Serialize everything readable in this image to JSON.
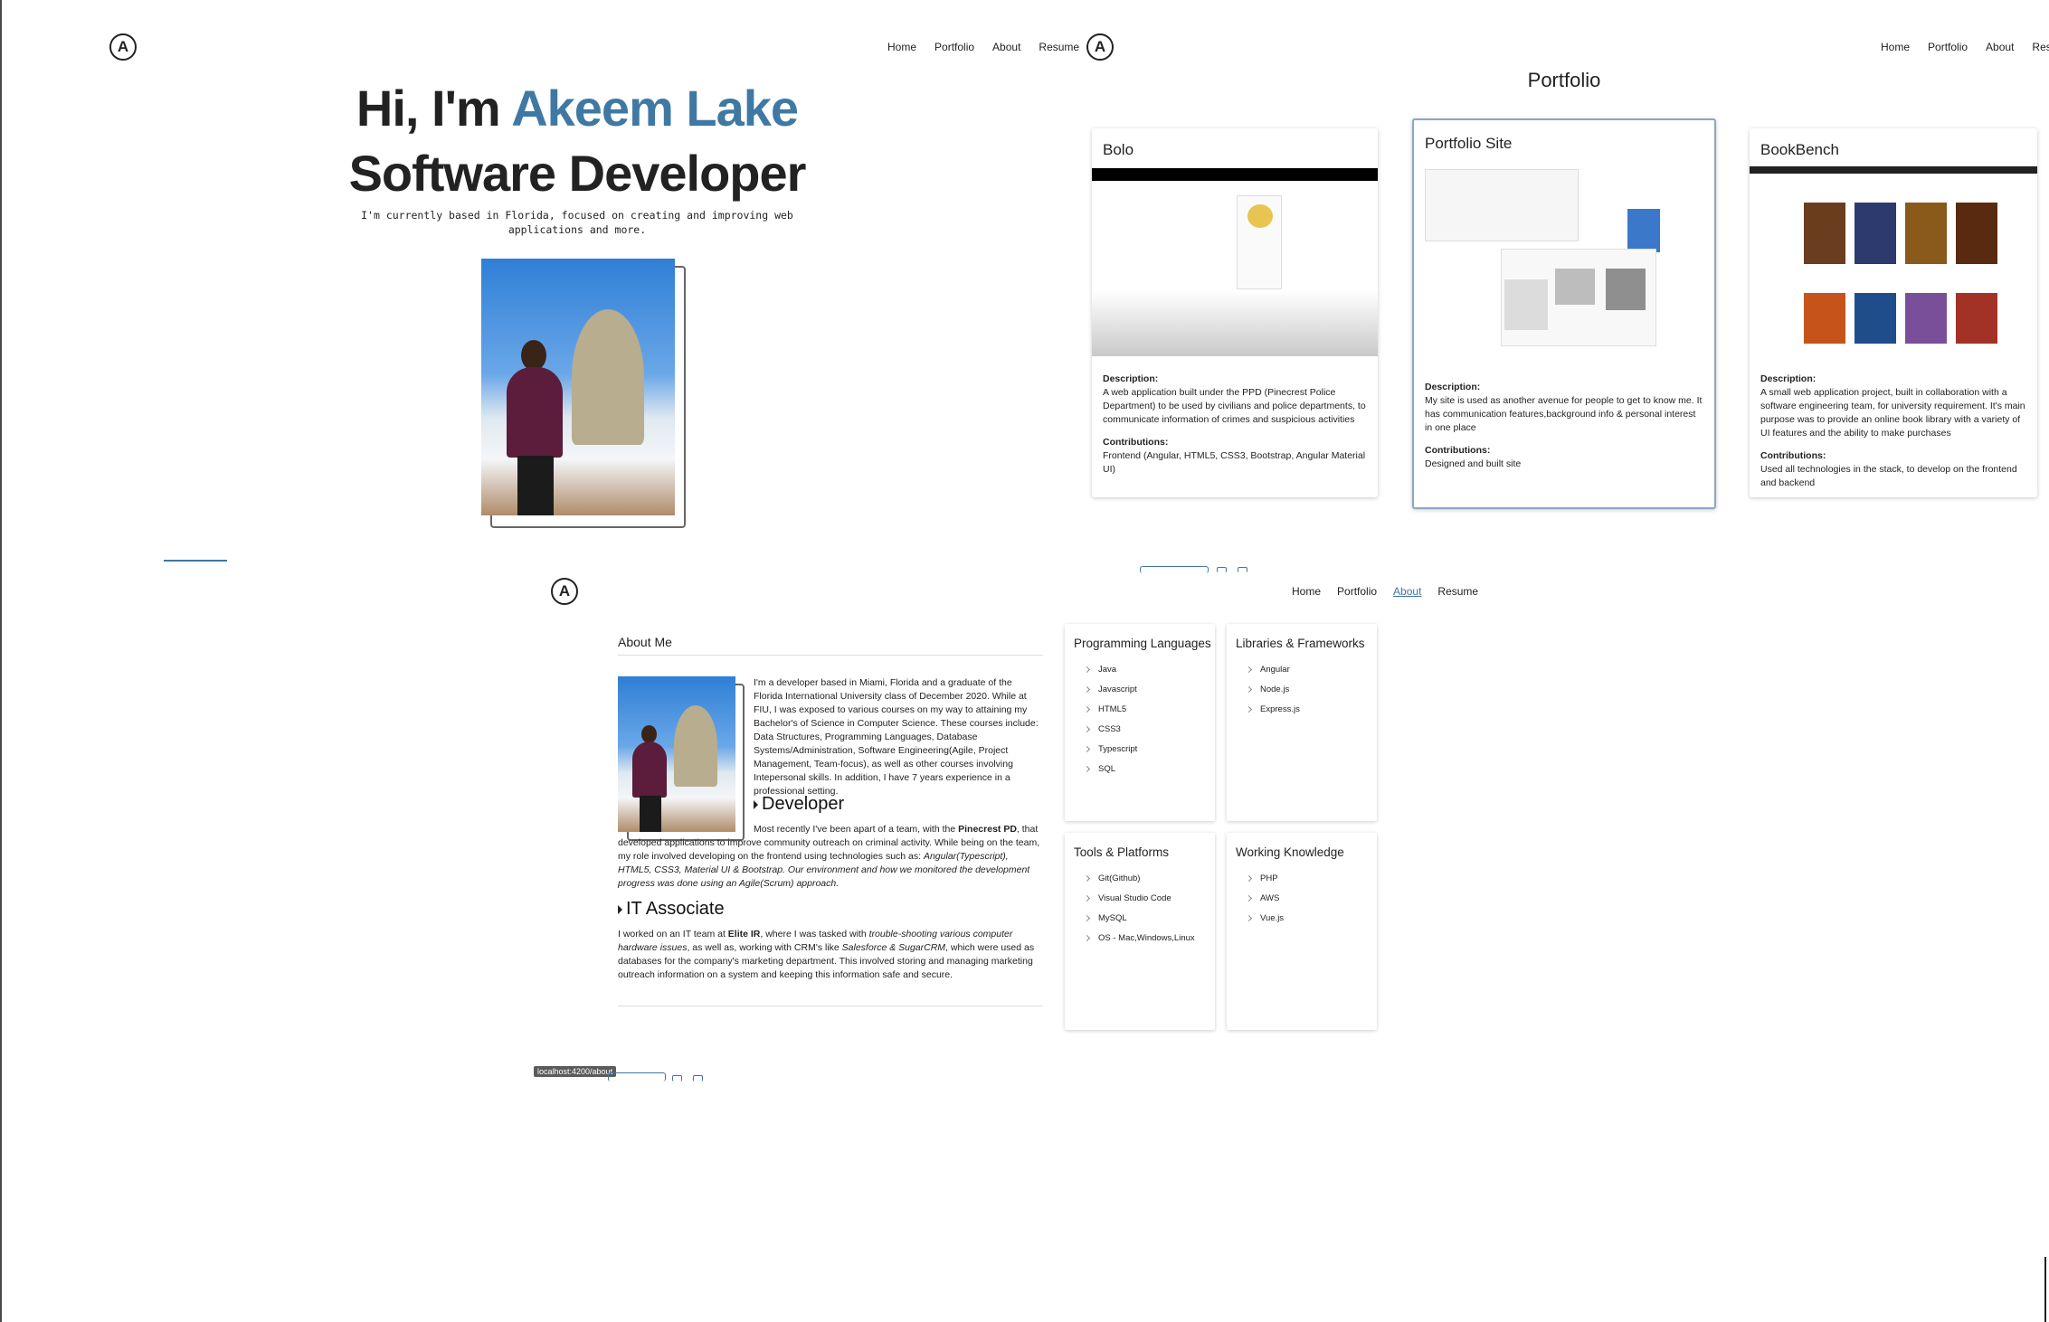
{
  "nav": {
    "items": [
      "Home",
      "Portfolio",
      "About",
      "Resume"
    ]
  },
  "logo": {
    "letter": "A"
  },
  "home": {
    "greeting": "Hi, I'm",
    "name": "Akeem Lake",
    "role": "Software Developer",
    "intro_line1": "I'm currently based in Florida, focused on creating and improving web",
    "intro_line2": "applications and more."
  },
  "portfolio": {
    "title": "Portfolio",
    "cards": [
      {
        "title": "Bolo",
        "description_label": "Description:",
        "description": "A web application built under the PPD (Pinecrest Police Department) to be used by civilians and police departments, to communicate information of crimes and suspicious activities",
        "contributions_label": "Contributions:",
        "contributions": "Frontend (Angular, HTML5, CSS3, Bootstrap, Angular Material UI)"
      },
      {
        "title": "Portfolio Site",
        "description_label": "Description:",
        "description": "My site is used as another avenue for people to get to know me. It has communication features,background info & personal interest in one place",
        "contributions_label": "Contributions:",
        "contributions": "Designed and built site"
      },
      {
        "title": "BookBench",
        "description_label": "Description:",
        "description": "A small web application project, built in collaboration with a software engineering team, for university requirement. It's main purpose was to provide an online book library with a variety of UI features and the ability to make purchases",
        "contributions_label": "Contributions:",
        "contributions": "Used all technologies in the stack, to develop on the frontend and backend"
      }
    ]
  },
  "about": {
    "title": "About Me",
    "intro": "I'm a developer based in Miami, Florida and a graduate of the Florida International University class of December 2020. While at FIU, I was exposed to various courses on my way to attaining my Bachelor's of Science in Computer Science. These courses include: Data Structures, Programming Languages, Database Systems/Administration, Software Engineering(Agile, Project Management, Team-focus), as well as other courses involving Intepersonal skills. In addition, I have 7 years experience in a professional setting.",
    "developer_heading": "Developer",
    "developer_p1": "Most recently I've been apart of a team, with the ",
    "developer_org": "Pinecrest PD",
    "developer_p2": ", that developed applications to improve community outreach on criminal activity. While being on the team, my role involved developing on the frontend using technologies such as: ",
    "developer_tech": "Angular(Typescript), HTML5, CSS3, Material UI & Bootstrap. Our environment and how we monitored the development progress was done using an Agile(Scrum) approach.",
    "it_heading": "IT Associate",
    "it_p1": "I worked on an IT team at ",
    "it_org": "Elite IR",
    "it_p2": ", where I was tasked with ",
    "it_italic1": "trouble-shooting various computer hardware issues",
    "it_p3": ", as well as, working with CRM's like ",
    "it_italic2": "Salesforce & SugarCRM",
    "it_p4": ", which were used as databases for the company's marketing department. This involved storing and managing marketing outreach information on a system and keeping this information safe and secure."
  },
  "skills": [
    {
      "title": "Programming Languages",
      "items": [
        "Java",
        "Javascript",
        "HTML5",
        "CSS3",
        "Typescript",
        "SQL"
      ]
    },
    {
      "title": "Libraries & Frameworks",
      "items": [
        "Angular",
        "Node.js",
        "Express.js"
      ]
    },
    {
      "title": "Tools & Platforms",
      "items": [
        "Git(Github)",
        "Visual Studio Code",
        "MySQL",
        "OS - Mac,Windows,Linux"
      ]
    },
    {
      "title": "Working Knowledge",
      "items": [
        "PHP",
        "AWS",
        "Vue.js"
      ]
    }
  ],
  "status_tooltip": "localhost:4200/about",
  "colors": {
    "accent": "#3f79a3",
    "text": "#222222",
    "card_border": "#8aa7c7"
  }
}
